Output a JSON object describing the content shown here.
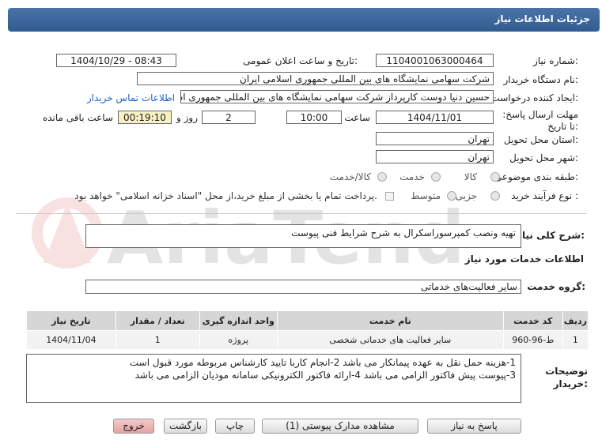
{
  "header": {
    "title": "جزئیات اطلاعات نیاز"
  },
  "form": {
    "need_number_label": "شماره نیاز:",
    "need_number": "1104001063000464",
    "announce_label": "تاریخ و ساعت اعلان عمومی:",
    "announce_value": "1404/10/29 - 08:43",
    "buyer_org_label": "نام دستگاه خریدار:",
    "buyer_org": "شرکت سهامی نمایشگاه های بین المللی جمهوری اسلامی ایران",
    "creator_label": "ایجاد کننده درخواست:",
    "creator": "حسین دنیا دوست کارپرداز شرکت سهامی نمایشگاه های بین المللی جمهوری اسلامی ایران",
    "contact_link": "اطلاعات تماس خریدار",
    "deadline_label": "مهلت ارسال پاسخ: تا تاریخ:",
    "deadline_date": "1404/11/01",
    "time_label": "ساعت",
    "deadline_time": "10:00",
    "days_value": "2",
    "days_label": "روز و",
    "remaining_time": "00:19:10",
    "remaining_label": "ساعت باقی مانده",
    "province_label": "استان محل تحویل:",
    "province": "تهران",
    "city_label": "شهر محل تحویل:",
    "city": "تهران",
    "category_label": "طبقه بندی موضوعی:",
    "category_options": [
      "کالا",
      "خدمت",
      "کالا/خدمت"
    ],
    "process_label": "نوع فرآیند خرید :",
    "process_options": [
      "جزیی",
      "متوسط"
    ],
    "process_note": "پرداخت تمام یا بخشی از مبلغ خرید،از محل \"اسناد خزانه اسلامی\" خواهد بود."
  },
  "summary": {
    "label": "شرح کلی نیاز:",
    "text": "تهیه ونصب کمپرسوراسکرال به شرح شرایط فنی پیوست"
  },
  "services": {
    "section_title": "اطلاعات خدمات مورد نیاز",
    "group_label": "گروه خدمت:",
    "group_value": "سایر فعالیت‌های خدماتی",
    "columns": [
      "ردیف",
      "کد خدمت",
      "نام خدمت",
      "واحد اندازه گیری",
      "تعداد / مقدار",
      "تاریخ نیاز"
    ],
    "rows": [
      [
        "1",
        "ط-96-960",
        "سایر فعالیت های خدماتی شخصی",
        "پروژه",
        "1",
        "1404/11/04"
      ]
    ]
  },
  "notes": {
    "label": "توضیحات خریدار:",
    "line1": "1-هزینه حمل نقل به عهده پیمانکار می باشد 2-انجام کاربا تایید کارشناس مربوطه مورد قبول است",
    "line2": "3-پیوست پیش فاکتور الزامی می باشد 4-ارائه فاکتور الکترونیکی سامانه مودیان الزامی می باشد"
  },
  "buttons": {
    "reply": "پاسخ به نیاز",
    "attachments": "مشاهده مدارک پیوستی (1)",
    "print": "چاپ",
    "back": "بازگشت",
    "exit": "خروج"
  },
  "watermark": {
    "text": "AriaTender.net"
  },
  "colors": {
    "header": "#315c92",
    "link": "#1d63c8",
    "highlight": "#f7f0c4",
    "exit": "#e5a2a5"
  }
}
